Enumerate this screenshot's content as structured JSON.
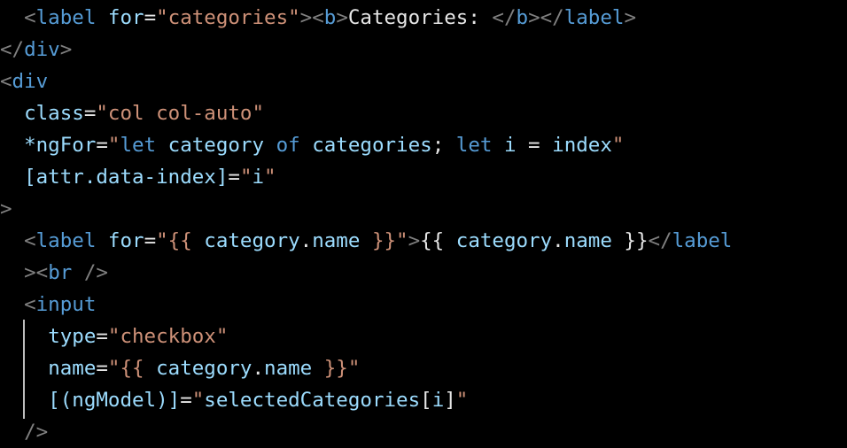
{
  "code": {
    "colors": {
      "background": "#000000",
      "punctuation": "#808080",
      "tag": "#569cd6",
      "attribute": "#9cdcfe",
      "string": "#ce9178",
      "text": "#e6e6e6",
      "keyword": "#569cd6"
    },
    "lines": [
      {
        "indent": "  ",
        "tokens": [
          {
            "t": "<",
            "c": "punct"
          },
          {
            "t": "label",
            "c": "tag"
          },
          {
            "t": " ",
            "c": "text"
          },
          {
            "t": "for",
            "c": "attr"
          },
          {
            "t": "=",
            "c": "text"
          },
          {
            "t": "\"categories\"",
            "c": "str"
          },
          {
            "t": "><",
            "c": "punct"
          },
          {
            "t": "b",
            "c": "tag"
          },
          {
            "t": ">",
            "c": "punct"
          },
          {
            "t": "Categories: ",
            "c": "text"
          },
          {
            "t": "</",
            "c": "punct"
          },
          {
            "t": "b",
            "c": "tag"
          },
          {
            "t": "></",
            "c": "punct"
          },
          {
            "t": "label",
            "c": "tag"
          },
          {
            "t": ">",
            "c": "punct"
          }
        ]
      },
      {
        "indent": "",
        "tokens": [
          {
            "t": "</",
            "c": "punct"
          },
          {
            "t": "div",
            "c": "tag"
          },
          {
            "t": ">",
            "c": "punct"
          }
        ]
      },
      {
        "indent": "",
        "tokens": [
          {
            "t": "<",
            "c": "punct"
          },
          {
            "t": "div",
            "c": "tag"
          }
        ]
      },
      {
        "indent": "  ",
        "tokens": [
          {
            "t": "class",
            "c": "attr"
          },
          {
            "t": "=",
            "c": "text"
          },
          {
            "t": "\"col col-auto\"",
            "c": "str"
          }
        ]
      },
      {
        "indent": "  ",
        "tokens": [
          {
            "t": "*ngFor",
            "c": "attr"
          },
          {
            "t": "=",
            "c": "text"
          },
          {
            "t": "\"",
            "c": "str"
          },
          {
            "t": "let",
            "c": "kw"
          },
          {
            "t": " ",
            "c": "text"
          },
          {
            "t": "category",
            "c": "expr"
          },
          {
            "t": " ",
            "c": "text"
          },
          {
            "t": "of",
            "c": "kw"
          },
          {
            "t": " ",
            "c": "text"
          },
          {
            "t": "categories",
            "c": "expr"
          },
          {
            "t": "; ",
            "c": "text"
          },
          {
            "t": "let",
            "c": "kw"
          },
          {
            "t": " ",
            "c": "text"
          },
          {
            "t": "i",
            "c": "expr"
          },
          {
            "t": " = ",
            "c": "text"
          },
          {
            "t": "index",
            "c": "expr"
          },
          {
            "t": "\"",
            "c": "str"
          }
        ]
      },
      {
        "indent": "  ",
        "tokens": [
          {
            "t": "[attr.data-index]",
            "c": "attr"
          },
          {
            "t": "=",
            "c": "text"
          },
          {
            "t": "\"",
            "c": "str"
          },
          {
            "t": "i",
            "c": "expr"
          },
          {
            "t": "\"",
            "c": "str"
          }
        ]
      },
      {
        "indent": "",
        "tokens": [
          {
            "t": ">",
            "c": "punct"
          }
        ]
      },
      {
        "indent": "  ",
        "tokens": [
          {
            "t": "<",
            "c": "punct"
          },
          {
            "t": "label",
            "c": "tag"
          },
          {
            "t": " ",
            "c": "text"
          },
          {
            "t": "for",
            "c": "attr"
          },
          {
            "t": "=",
            "c": "text"
          },
          {
            "t": "\"{{ ",
            "c": "str"
          },
          {
            "t": "category",
            "c": "expr"
          },
          {
            "t": ".",
            "c": "text"
          },
          {
            "t": "name",
            "c": "expr"
          },
          {
            "t": " }}\"",
            "c": "str"
          },
          {
            "t": ">",
            "c": "punct"
          },
          {
            "t": "{{ ",
            "c": "text"
          },
          {
            "t": "category",
            "c": "expr"
          },
          {
            "t": ".",
            "c": "text"
          },
          {
            "t": "name",
            "c": "expr"
          },
          {
            "t": " }}",
            "c": "text"
          },
          {
            "t": "</",
            "c": "punct"
          },
          {
            "t": "label",
            "c": "tag"
          }
        ]
      },
      {
        "indent": "  ",
        "tokens": [
          {
            "t": "><",
            "c": "punct"
          },
          {
            "t": "br",
            "c": "tag"
          },
          {
            "t": " />",
            "c": "punct"
          }
        ]
      },
      {
        "indent": "  ",
        "tokens": [
          {
            "t": "<",
            "c": "punct"
          },
          {
            "t": "input",
            "c": "tag"
          }
        ]
      },
      {
        "indent": "    ",
        "tokens": [
          {
            "t": "type",
            "c": "attr"
          },
          {
            "t": "=",
            "c": "text"
          },
          {
            "t": "\"checkbox\"",
            "c": "str"
          }
        ]
      },
      {
        "indent": "    ",
        "tokens": [
          {
            "t": "name",
            "c": "attr"
          },
          {
            "t": "=",
            "c": "text"
          },
          {
            "t": "\"{{ ",
            "c": "str"
          },
          {
            "t": "category",
            "c": "expr"
          },
          {
            "t": ".",
            "c": "text"
          },
          {
            "t": "name",
            "c": "expr"
          },
          {
            "t": " }}\"",
            "c": "str"
          }
        ]
      },
      {
        "indent": "    ",
        "tokens": [
          {
            "t": "[(ngModel)]",
            "c": "attr"
          },
          {
            "t": "=",
            "c": "text"
          },
          {
            "t": "\"",
            "c": "str"
          },
          {
            "t": "selectedCategories",
            "c": "expr"
          },
          {
            "t": "[",
            "c": "text"
          },
          {
            "t": "i",
            "c": "expr"
          },
          {
            "t": "]",
            "c": "text"
          },
          {
            "t": "\"",
            "c": "str"
          }
        ]
      },
      {
        "indent": "  ",
        "tokens": [
          {
            "t": "/>",
            "c": "punct"
          }
        ]
      }
    ]
  }
}
